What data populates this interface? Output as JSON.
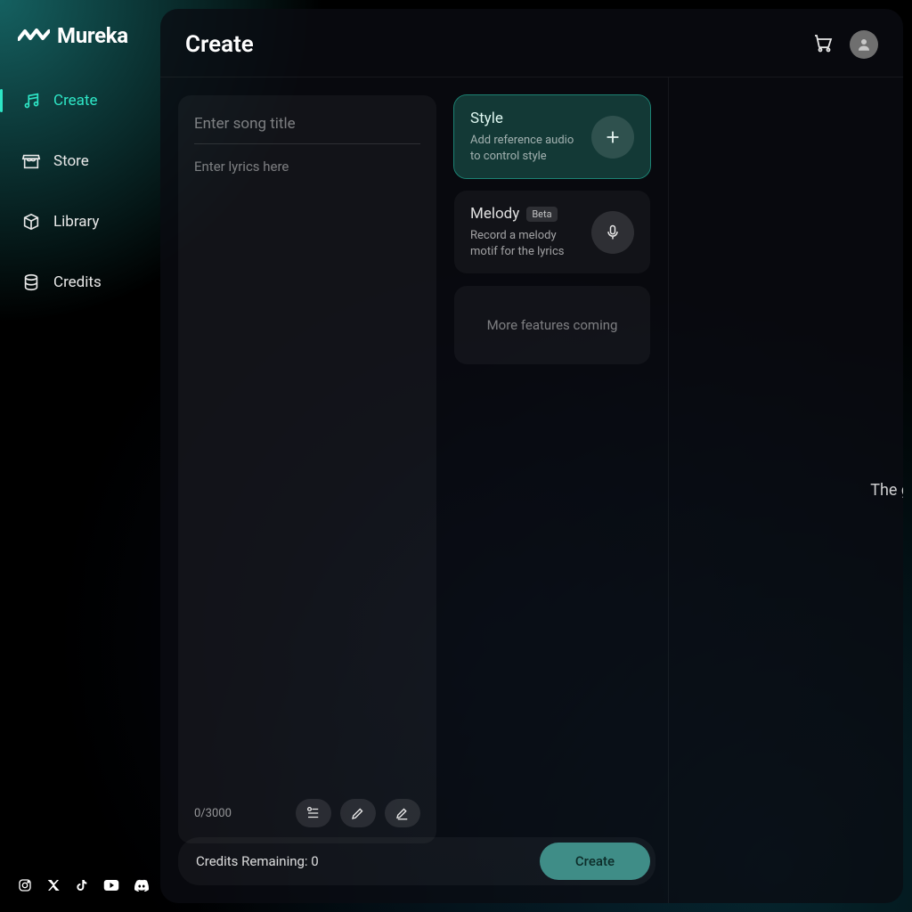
{
  "brand": {
    "name": "Mureka"
  },
  "sidebar": {
    "items": [
      {
        "label": "Create",
        "active": true
      },
      {
        "label": "Store",
        "active": false
      },
      {
        "label": "Library",
        "active": false
      },
      {
        "label": "Credits",
        "active": false
      }
    ]
  },
  "header": {
    "title": "Create"
  },
  "compose": {
    "title_placeholder": "Enter song title",
    "lyrics_placeholder": "Enter lyrics here",
    "char_current": 0,
    "char_max": 3000,
    "char_display": "0/3000"
  },
  "cards": {
    "style": {
      "title": "Style",
      "sub": "Add reference audio to control style"
    },
    "melody": {
      "title": "Melody",
      "badge": "Beta",
      "sub": "Record a melody motif for the lyrics"
    },
    "more": "More features coming"
  },
  "right": {
    "text": "The g"
  },
  "footer": {
    "credits_label": "Credits Remaining: 0",
    "credits_remaining": 0,
    "create_label": "Create"
  },
  "socials": [
    {
      "name": "instagram"
    },
    {
      "name": "x-twitter"
    },
    {
      "name": "tiktok"
    },
    {
      "name": "youtube"
    },
    {
      "name": "discord"
    }
  ],
  "colors": {
    "accent": "#2ee6c6",
    "panel": "rgba(255,255,255,0.045)",
    "highlight_bg": "rgba(46,170,150,0.30)"
  }
}
